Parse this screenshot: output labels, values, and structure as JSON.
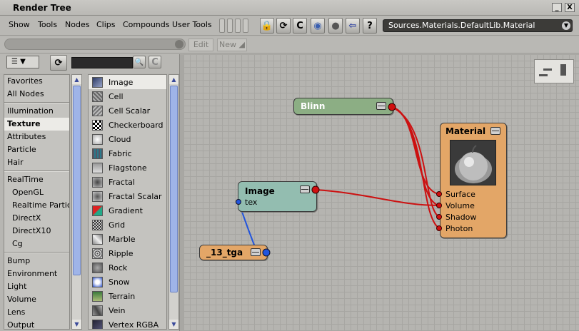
{
  "window": {
    "title": "Render Tree",
    "minimize": "_",
    "close": "X"
  },
  "menu": [
    "Show",
    "Tools",
    "Nodes",
    "Clips",
    "Compounds",
    "User Tools"
  ],
  "toolbar_icons": [
    "lock-icon",
    "refresh-icon",
    "c-icon",
    "globe-icon",
    "sphere-icon",
    "back-arrow-icon",
    "help-icon"
  ],
  "toolbar_glyphs": {
    "lock": "🔒",
    "refresh": "⟳",
    "c": "C",
    "globe": "◉",
    "sphere": "●",
    "back": "⇦",
    "help": "?"
  },
  "path": {
    "value": "Sources.Materials.DefaultLib.Material",
    "dropdown": "▼"
  },
  "row2": {
    "edit": "Edit",
    "new": "New ◢"
  },
  "browser": {
    "view_glyph": "☰ ▼",
    "refresh": "⟳",
    "search_icon": "🔍",
    "clear_icon": "C",
    "categories_1": [
      "Favorites",
      "All Nodes"
    ],
    "categories_2": [
      "Illumination",
      "Texture",
      "Attributes",
      "Particle",
      "Hair"
    ],
    "categories_3": [
      "RealTime"
    ],
    "categories_3_sub": [
      "OpenGL",
      "Realtime Particle",
      "DirectX",
      "DirectX10",
      "Cg"
    ],
    "categories_4": [
      "Bump",
      "Environment",
      "Light",
      "Volume",
      "Lens",
      "Output"
    ],
    "selected_category": "Texture",
    "nodes": [
      "Image",
      "Cell",
      "Cell Scalar",
      "Checkerboard",
      "Cloud",
      "Fabric",
      "Flagstone",
      "Fractal",
      "Fractal Scalar",
      "Gradient",
      "Grid",
      "Marble",
      "Ripple",
      "Rock",
      "Snow",
      "Terrain",
      "Vein",
      "Vertex RGBA"
    ],
    "selected_node": "Image",
    "scroll_up": "▲",
    "scroll_down": "▼"
  },
  "graph": {
    "blinn": {
      "title": "Blinn"
    },
    "image": {
      "title": "Image",
      "port": "tex"
    },
    "clip": {
      "title": "_13_tga"
    },
    "material": {
      "title": "Material",
      "ports": [
        "Surface",
        "Volume",
        "Shadow",
        "Photon"
      ]
    }
  },
  "colors": {
    "blinn_node": "#8cae84",
    "image_node": "#93bdb0",
    "clip_node": "#e3a667",
    "material_node": "#e3a667",
    "connection_red": "#cc1111",
    "connection_blue": "#2255dd"
  }
}
